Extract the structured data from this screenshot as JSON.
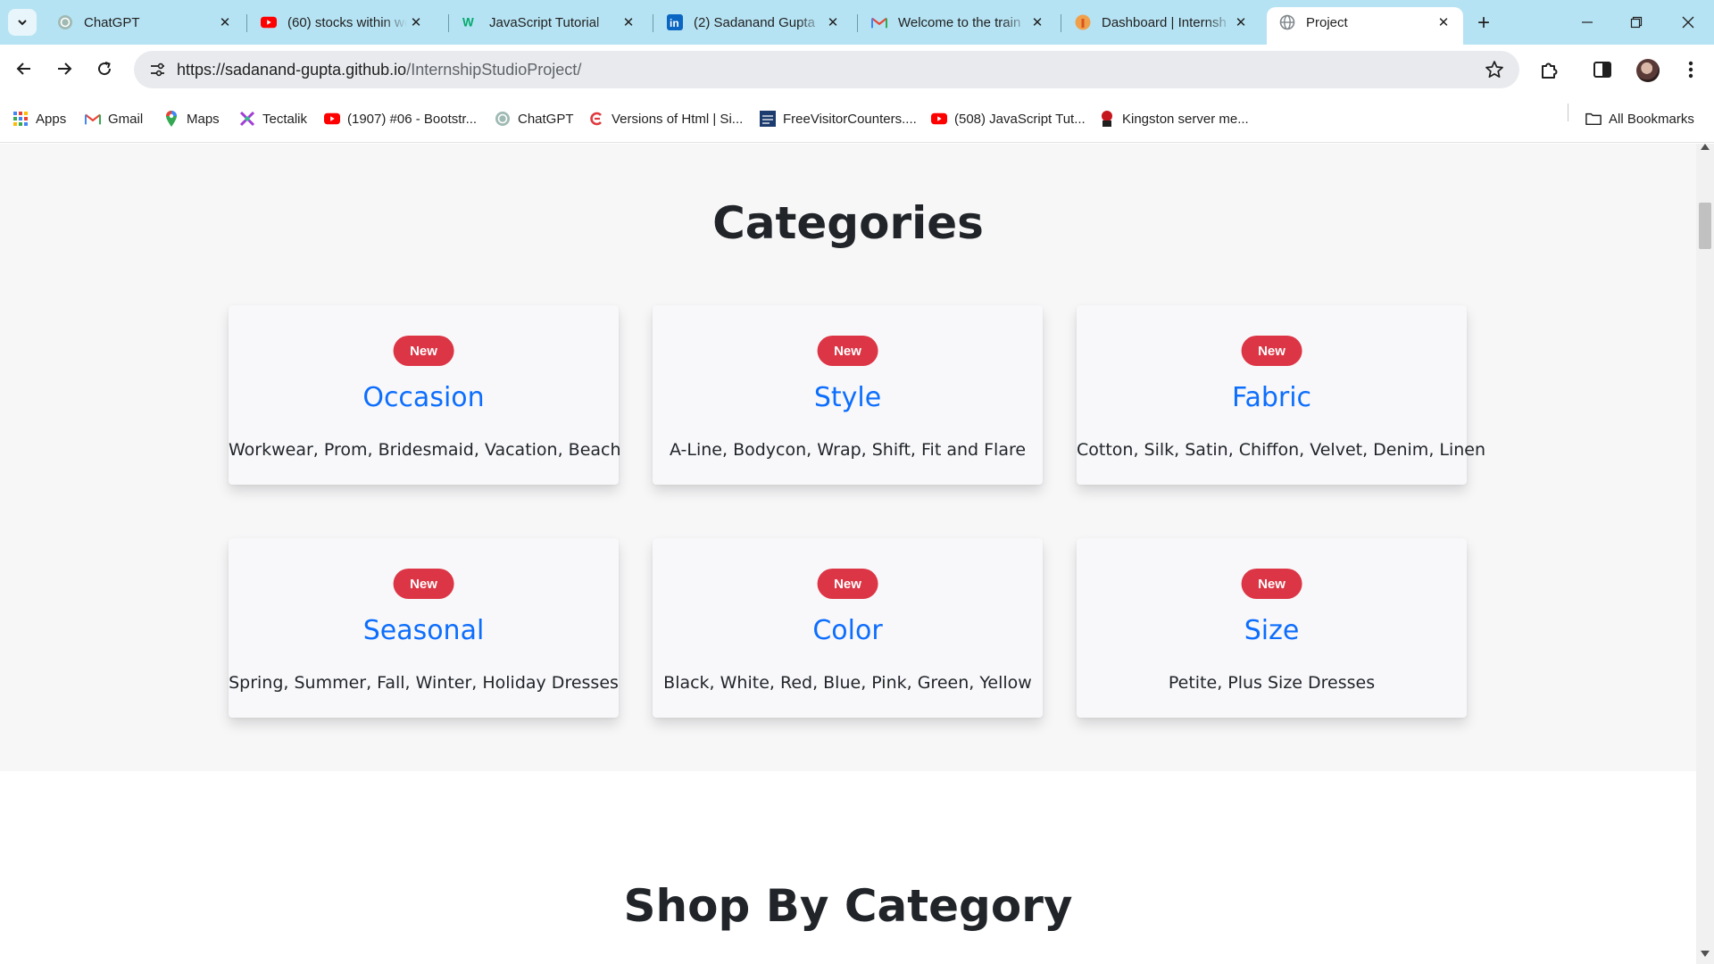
{
  "browser": {
    "tabs": [
      {
        "title": "ChatGPT",
        "icon": "chatgpt-icon",
        "active": false
      },
      {
        "title": "(60) stocks within we",
        "icon": "youtube-icon",
        "active": false
      },
      {
        "title": "JavaScript Tutorial",
        "icon": "w3schools-icon",
        "active": false
      },
      {
        "title": "(2) Sadanand Gupta",
        "icon": "linkedin-icon",
        "active": false
      },
      {
        "title": "Welcome to the train",
        "icon": "gmail-icon",
        "active": false
      },
      {
        "title": "Dashboard | Internsh",
        "icon": "internshala-icon",
        "active": false
      },
      {
        "title": "Project",
        "icon": "globe-icon",
        "active": true
      }
    ],
    "url": {
      "host": "https://sadanand-gupta.github.io",
      "path": "/InternshipStudioProject/"
    },
    "bookmarks": [
      {
        "label": "Apps",
        "icon": "apps-grid-icon"
      },
      {
        "label": "Gmail",
        "icon": "gmail-icon"
      },
      {
        "label": "Maps",
        "icon": "maps-icon"
      },
      {
        "label": "Tectalik",
        "icon": "tectalik-icon"
      },
      {
        "label": "(1907) #06 - Bootstr...",
        "icon": "youtube-icon"
      },
      {
        "label": "ChatGPT",
        "icon": "chatgpt-icon"
      },
      {
        "label": "Versions of Html | Si...",
        "icon": "versions-icon"
      },
      {
        "label": "FreeVisitorCounters....",
        "icon": "counter-icon"
      },
      {
        "label": "(508) JavaScript Tut...",
        "icon": "youtube-icon"
      },
      {
        "label": "Kingston server me...",
        "icon": "kingston-icon"
      }
    ],
    "all_bookmarks_label": "All Bookmarks"
  },
  "page": {
    "categories_title": "Categories",
    "cards": [
      {
        "badge": "New",
        "title": "Occasion",
        "text": "Workwear, Prom, Bridesmaid, Vacation, Beach"
      },
      {
        "badge": "New",
        "title": "Style",
        "text": "A-Line, Bodycon, Wrap, Shift, Fit and Flare"
      },
      {
        "badge": "New",
        "title": "Fabric",
        "text": "Cotton, Silk, Satin, Chiffon, Velvet, Denim, Linen"
      },
      {
        "badge": "New",
        "title": "Seasonal",
        "text": "Spring, Summer, Fall, Winter, Holiday Dresses"
      },
      {
        "badge": "New",
        "title": "Color",
        "text": "Black, White, Red, Blue, Pink, Green, Yellow"
      },
      {
        "badge": "New",
        "title": "Size",
        "text": "Petite, Plus Size Dresses"
      }
    ],
    "shop_title": "Shop By Category"
  },
  "colors": {
    "tabstrip": "#b6e3f3",
    "badge": "#dc3545",
    "card_title": "#0d6efd",
    "section_bg": "#f7f7f8"
  }
}
